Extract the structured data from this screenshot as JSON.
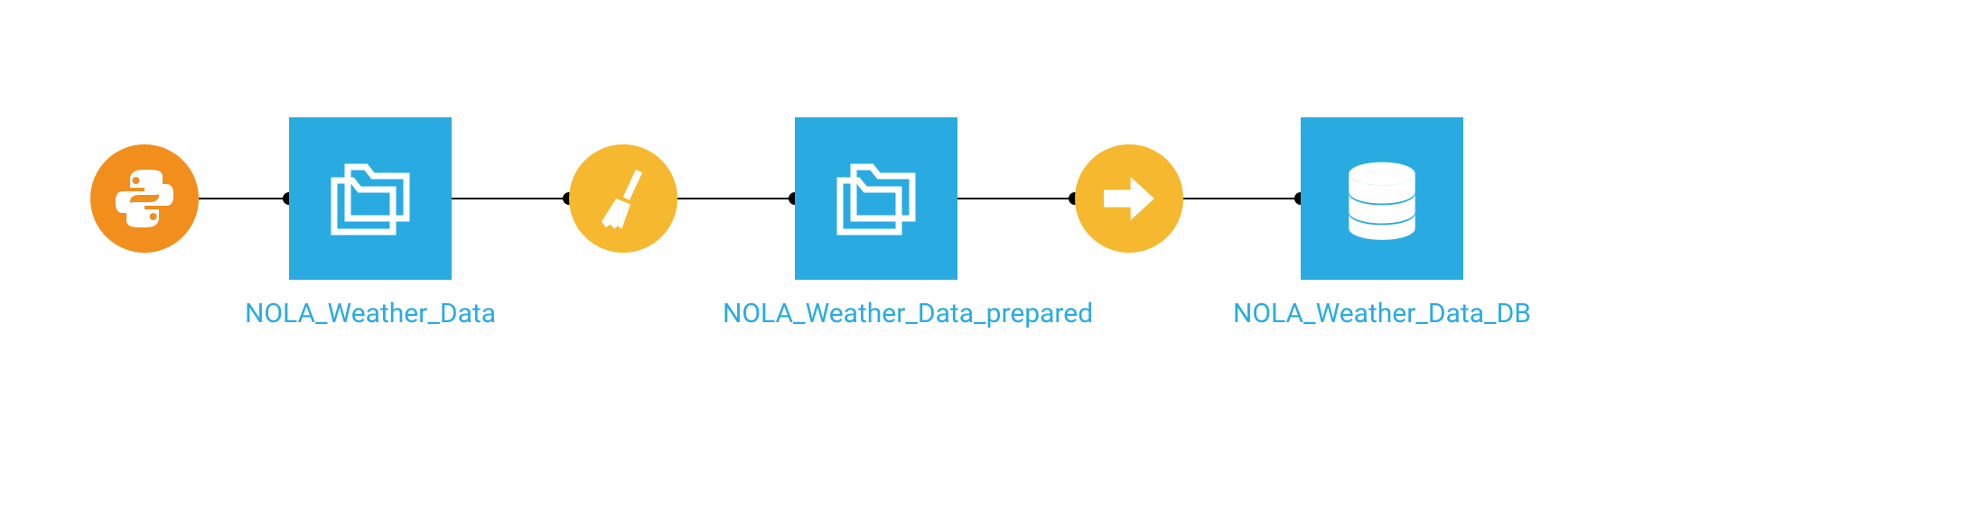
{
  "flow": {
    "nodes": [
      {
        "id": "python-recipe",
        "type": "circle",
        "color": "orange",
        "icon": "python",
        "label": null
      },
      {
        "id": "dataset-1",
        "type": "square",
        "color": "blue",
        "icon": "folder",
        "label": "NOLA_Weather_Data"
      },
      {
        "id": "prepare-recipe",
        "type": "circle",
        "color": "yellow",
        "icon": "broom",
        "label": null
      },
      {
        "id": "dataset-2",
        "type": "square",
        "color": "blue",
        "icon": "folder",
        "label": "NOLA_Weather_Data_prepared"
      },
      {
        "id": "sync-recipe",
        "type": "circle",
        "color": "yellow",
        "icon": "arrow",
        "label": null
      },
      {
        "id": "dataset-3",
        "type": "square",
        "color": "blue",
        "icon": "database",
        "label": "NOLA_Weather_Data_DB"
      }
    ],
    "colors": {
      "orange": "#f18e1c",
      "yellow": "#f5b82e",
      "blue": "#29abe2",
      "link_text": "#29abe2"
    }
  }
}
